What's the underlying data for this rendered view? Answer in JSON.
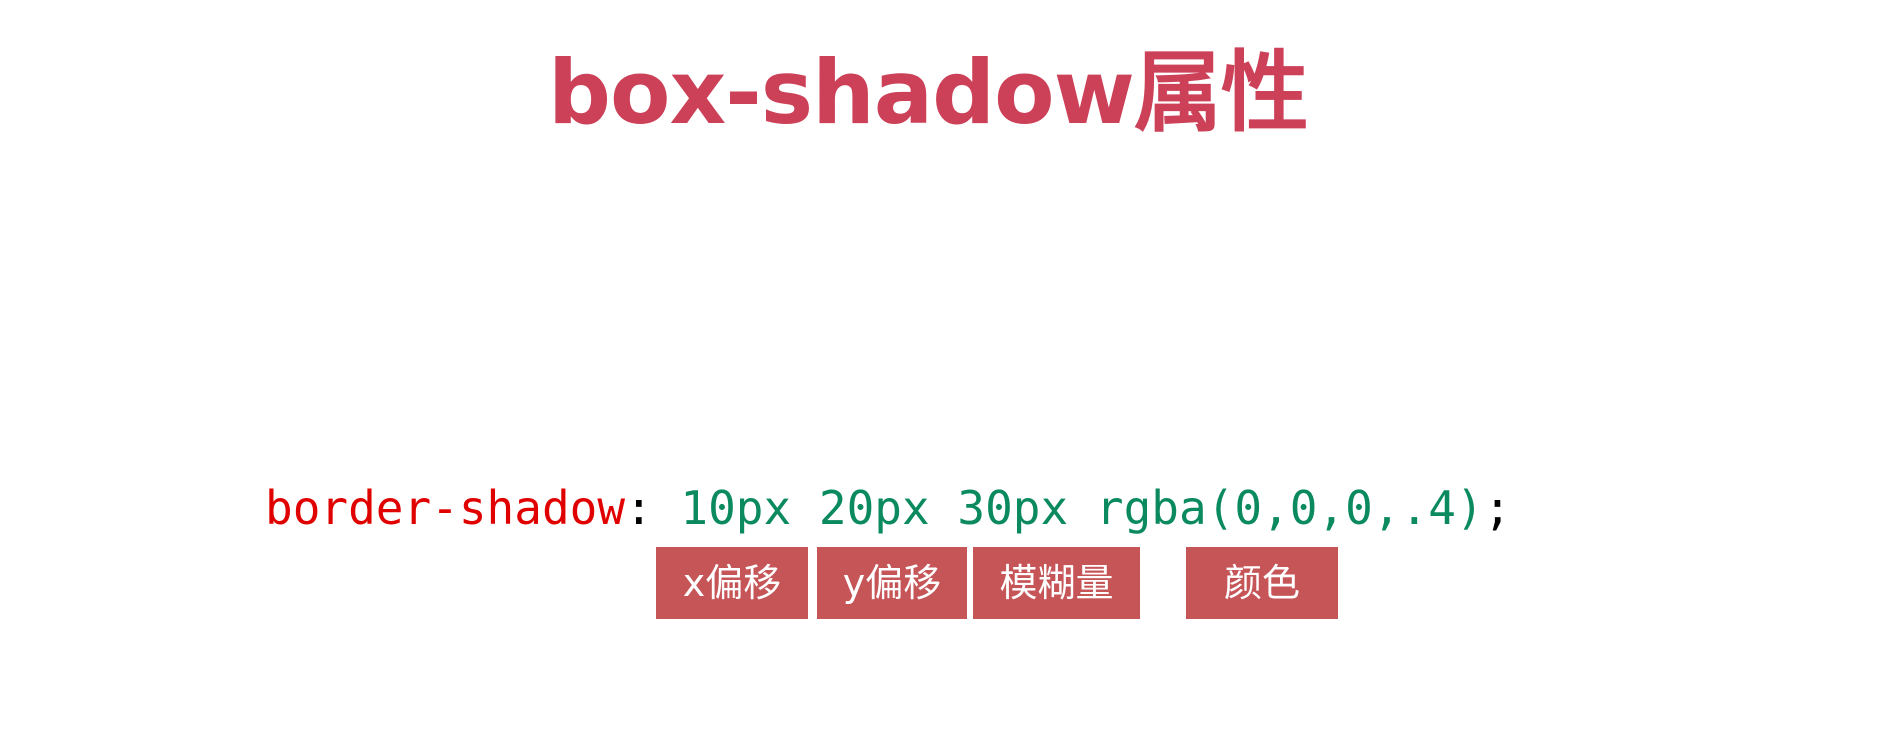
{
  "title": "box-shadow属性",
  "code": {
    "property": "border-shadow",
    "colon": ": ",
    "x_offset": "10px",
    "y_offset": "20px",
    "blur": "30px",
    "color_value": "rgba(0,0,0,.4)",
    "terminator": ";"
  },
  "labels": {
    "x_offset": "x偏移",
    "y_offset": "y偏移",
    "blur": "模糊量",
    "color": "颜色"
  },
  "colors": {
    "title": "#cc4058",
    "property": "#e00000",
    "value": "#0a8a5e",
    "label_bg": "#c65558",
    "label_text": "#ffffff"
  }
}
